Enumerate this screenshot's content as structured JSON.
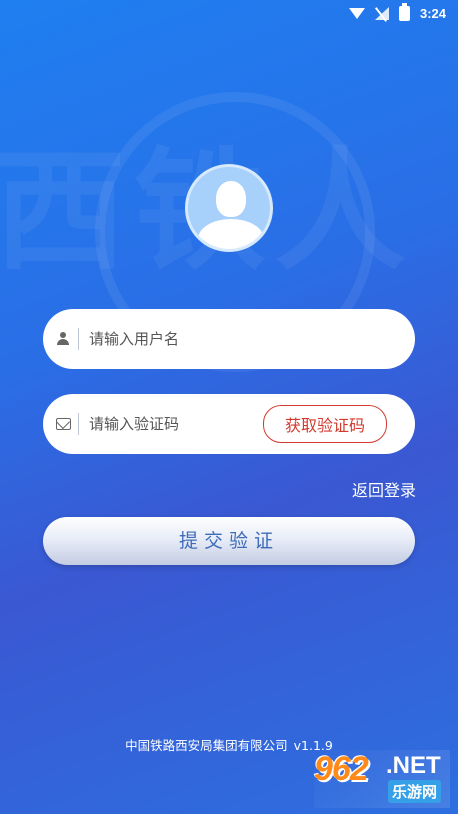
{
  "status_bar": {
    "time": "3:24",
    "icons": [
      "wifi-icon",
      "no-signal-icon",
      "battery-icon"
    ]
  },
  "background": {
    "watermark": "西铁人"
  },
  "avatar": {
    "icon": "user-avatar-icon"
  },
  "username": {
    "placeholder": "请输入用户名",
    "value": "",
    "icon": "person-icon"
  },
  "code": {
    "placeholder": "请输入验证码",
    "value": "",
    "icon": "mail-icon",
    "get_code_label": "获取验证码"
  },
  "back_login_label": "返回登录",
  "submit_label": "提交验证",
  "footer": {
    "company": "中国铁路西安局集团有限公司",
    "version": "v1.1.9"
  },
  "brand": {
    "number": "962",
    "net": ".NET",
    "sub": "乐游网"
  },
  "colors": {
    "primary": "#2a6ee6",
    "accent_red": "#d33a2f",
    "submit_text": "#3f6cb8"
  }
}
